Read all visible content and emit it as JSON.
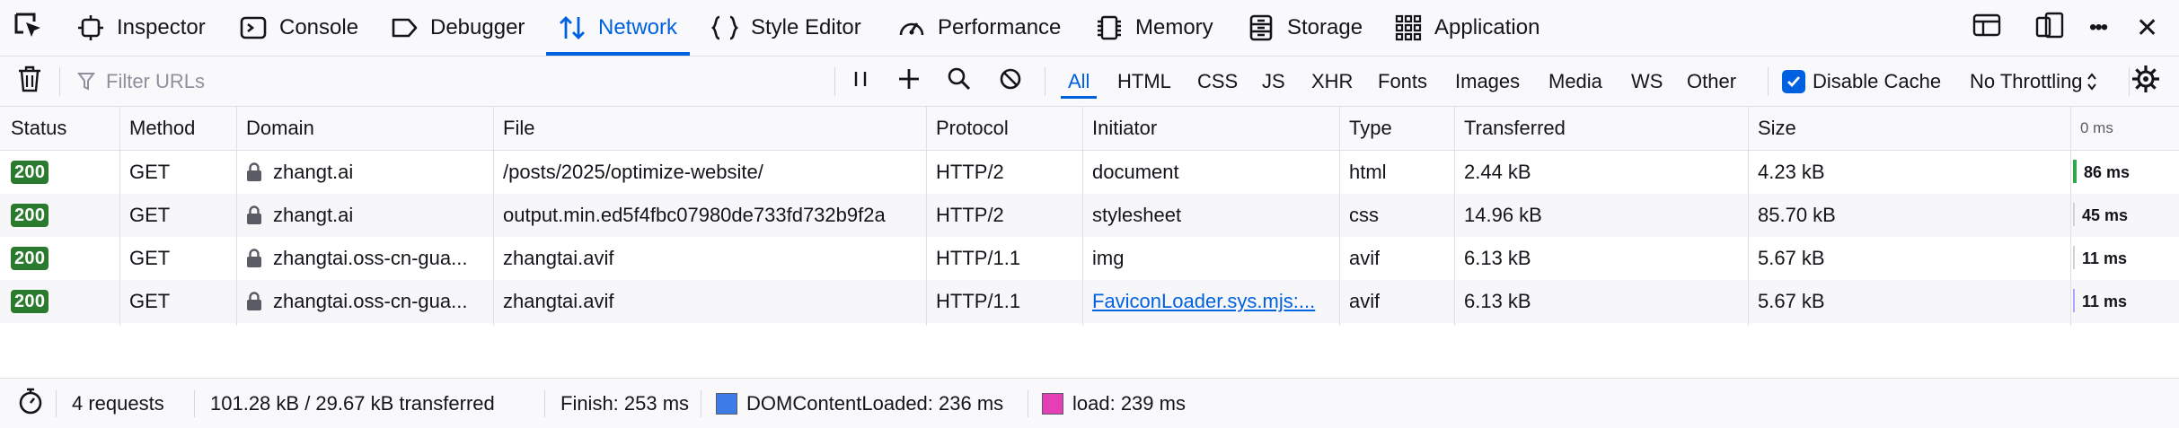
{
  "toolbox": {
    "tabs": [
      {
        "label": "Inspector",
        "icon": "inspector-icon"
      },
      {
        "label": "Console",
        "icon": "console-icon"
      },
      {
        "label": "Debugger",
        "icon": "debugger-icon"
      },
      {
        "label": "Network",
        "icon": "network-icon",
        "selected": true
      },
      {
        "label": "Style Editor",
        "icon": "style-editor-icon"
      },
      {
        "label": "Performance",
        "icon": "performance-icon"
      },
      {
        "label": "Memory",
        "icon": "memory-icon"
      },
      {
        "label": "Storage",
        "icon": "storage-icon"
      },
      {
        "label": "Application",
        "icon": "application-icon"
      }
    ],
    "more_label": "•••",
    "close_label": "✕"
  },
  "toolbar": {
    "filter_placeholder": "Filter URLs",
    "filter_value": "",
    "type_filters": [
      "All",
      "HTML",
      "CSS",
      "JS",
      "XHR",
      "Fonts",
      "Images",
      "Media",
      "WS",
      "Other"
    ],
    "active_filter": "All",
    "disable_cache_label": "Disable Cache",
    "disable_cache_checked": true,
    "throttling_label": "No Throttling"
  },
  "columns": {
    "status": "Status",
    "method": "Method",
    "domain": "Domain",
    "file": "File",
    "protocol": "Protocol",
    "initiator": "Initiator",
    "type": "Type",
    "transferred": "Transferred",
    "size": "Size",
    "waterfall": "0 ms"
  },
  "requests": [
    {
      "status": "200",
      "method": "GET",
      "domain": "zhangt.ai",
      "file": "/posts/2025/optimize-website/",
      "protocol": "HTTP/2",
      "initiator": "document",
      "initiator_link": false,
      "type": "html",
      "transferred": "2.44 kB",
      "size": "4.23 kB",
      "timing": "86 ms",
      "timing_ms": 86,
      "timing_color": "#2fa84f"
    },
    {
      "status": "200",
      "method": "GET",
      "domain": "zhangt.ai",
      "file": "output.min.ed5f4fbc07980de733fd732b9f2a",
      "protocol": "HTTP/2",
      "initiator": "stylesheet",
      "initiator_link": false,
      "type": "css",
      "transferred": "14.96 kB",
      "size": "85.70 kB",
      "timing": "45 ms",
      "timing_ms": 45,
      "timing_color": "#d2d2d8"
    },
    {
      "status": "200",
      "method": "GET",
      "domain": "zhangtai.oss-cn-gua...",
      "file": "zhangtai.avif",
      "protocol": "HTTP/1.1",
      "initiator": "img",
      "initiator_link": false,
      "type": "avif",
      "transferred": "6.13 kB",
      "size": "5.67 kB",
      "timing": "11 ms",
      "timing_ms": 11,
      "timing_color": "#d2d2d8"
    },
    {
      "status": "200",
      "method": "GET",
      "domain": "zhangtai.oss-cn-gua...",
      "file": "zhangtai.avif",
      "protocol": "HTTP/1.1",
      "initiator": "FaviconLoader.sys.mjs:...",
      "initiator_link": true,
      "type": "avif",
      "transferred": "6.13 kB",
      "size": "5.67 kB",
      "timing": "11 ms",
      "timing_ms": 11,
      "timing_color": "#a9a9ff"
    }
  ],
  "footer": {
    "requests": "4 requests",
    "transferred": "101.28 kB / 29.67 kB transferred",
    "finish": "Finish: 253 ms",
    "dom_content_loaded": "DOMContentLoaded: 236 ms",
    "dom_color": "#3d7ce6",
    "load": "load: 239 ms",
    "load_color": "#e63eb7"
  },
  "colors": {
    "accent": "#0061e0",
    "status_ok": "#2b7a2e"
  }
}
